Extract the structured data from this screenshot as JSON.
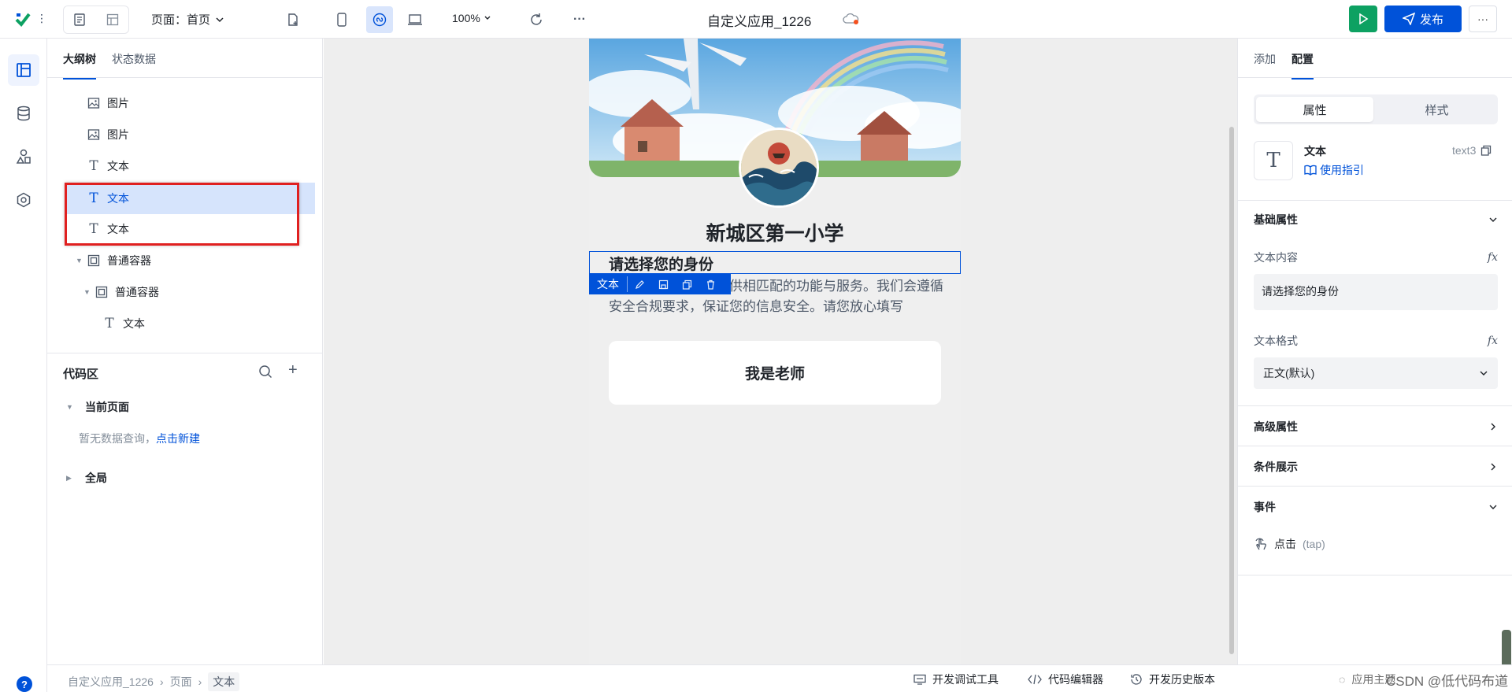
{
  "topbar": {
    "page_select": "页面：首页",
    "zoom": "100%",
    "app_title": "自定义应用_1226",
    "publish": "发布",
    "more": "···",
    "accent": "#0052d9",
    "run_color": "#0da162"
  },
  "outline": {
    "tabs": [
      "大纲树",
      "状态数据"
    ],
    "items": [
      {
        "label": "图片",
        "icon": "image-icon"
      },
      {
        "label": "图片",
        "icon": "image-icon"
      },
      {
        "label": "文本",
        "icon": "text-icon"
      },
      {
        "label": "文本",
        "icon": "text-icon"
      },
      {
        "label": "文本",
        "icon": "text-icon"
      },
      {
        "label": "普通容器",
        "icon": "container-icon"
      },
      {
        "label": "普通容器",
        "icon": "container-icon"
      },
      {
        "label": "文本",
        "icon": "text-icon"
      }
    ],
    "code_title": "代码区",
    "current_page": "当前页面",
    "empty_query": "暂无数据查询，",
    "create_link": "点击新建",
    "global": "全局"
  },
  "canvas": {
    "school": "新城区第一小学",
    "choose": "请选择您的身份",
    "toolbar_label": "文本",
    "desc": "根据您的身份为您提供相匹配的功能与服务。我们会遵循安全合规要求，保证您的信息安全。请您放心填写",
    "teacher": "我是老师"
  },
  "right": {
    "tabs": [
      "添加",
      "配置"
    ],
    "seg_attr": "属性",
    "seg_style": "样式",
    "comp_name": "文本",
    "comp_guide": "使用指引",
    "comp_id": "text3",
    "basic": "基础属性",
    "text_content_label": "文本内容",
    "text_content": "请选择您的身份",
    "text_format_label": "文本格式",
    "text_format": "正文(默认)",
    "advanced": "高级属性",
    "condition": "条件展示",
    "events": "事件",
    "tap": "点击",
    "tap_sub": "(tap)",
    "fx": "fx"
  },
  "bottom": {
    "crumbs": [
      "自定义应用_1226",
      "页面",
      "文本"
    ],
    "debug": "开发调试工具",
    "code_editor": "代码编辑器",
    "history": "开发历史版本",
    "watermark": "CSDN @低代码布道师",
    "apply_theme": "应用主题"
  }
}
